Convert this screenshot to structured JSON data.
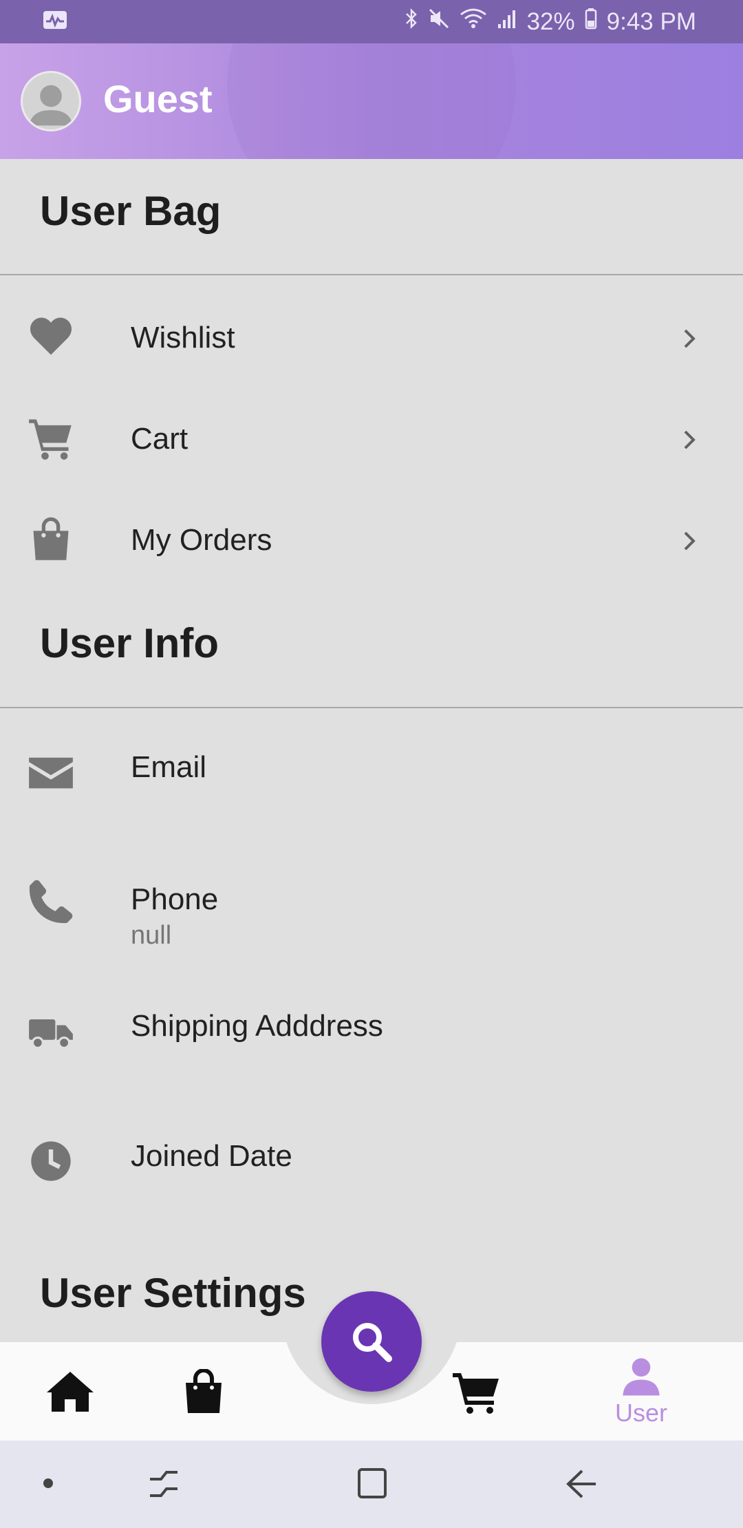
{
  "status_bar": {
    "battery": "32%",
    "time": "9:43 PM"
  },
  "header": {
    "user_name": "Guest"
  },
  "user_bag": {
    "title": "User Bag",
    "items": [
      {
        "label": "Wishlist",
        "icon": "heart-icon"
      },
      {
        "label": "Cart",
        "icon": "cart-icon"
      },
      {
        "label": "My Orders",
        "icon": "shopping-bag-icon"
      }
    ]
  },
  "user_info": {
    "title": "User Info",
    "items": [
      {
        "label": "Email",
        "icon": "envelope-icon",
        "value": ""
      },
      {
        "label": "Phone",
        "icon": "phone-icon",
        "value": "null"
      },
      {
        "label": "Shipping Adddress",
        "icon": "truck-icon",
        "value": ""
      },
      {
        "label": "Joined Date",
        "icon": "clock-icon",
        "value": ""
      }
    ]
  },
  "user_settings": {
    "title": "User Settings"
  },
  "bottom_nav": {
    "items": [
      {
        "id": "home",
        "icon": "home-icon"
      },
      {
        "id": "orders",
        "icon": "shopping-bag-icon"
      },
      {
        "id": "search",
        "icon": "search-icon"
      },
      {
        "id": "cart",
        "icon": "cart-icon"
      },
      {
        "id": "user",
        "icon": "user-icon",
        "label": "User",
        "active": true
      }
    ]
  },
  "colors": {
    "accent": "#6a35b3",
    "header_start": "#c8a2e8",
    "header_end": "#9c7fe0",
    "active_nav": "#b98ee0"
  }
}
